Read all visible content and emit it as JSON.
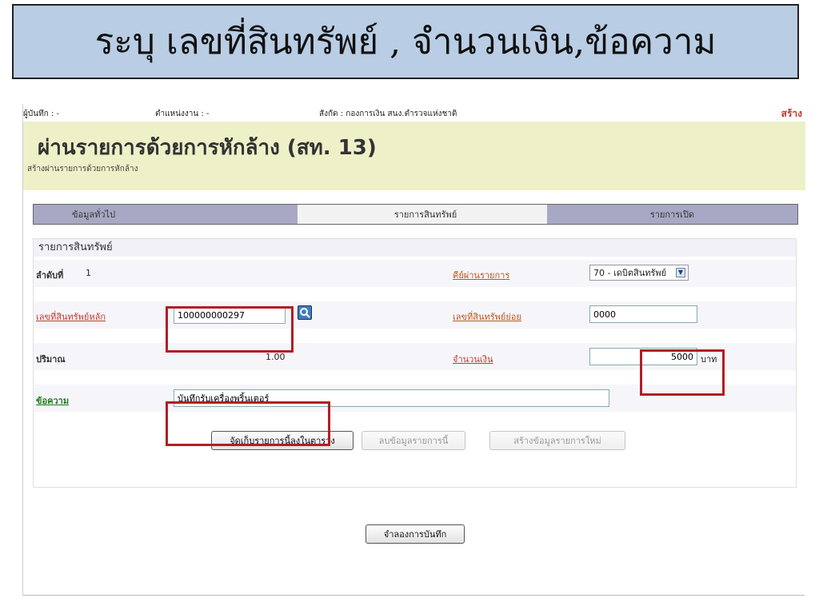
{
  "banner": {
    "text": "ระบุ เลขที่สินทรัพย์ , จำนวนเงิน,ข้อความ"
  },
  "userbar": {
    "recorder": "ผู้บันทึก : -",
    "position": "ตำแหน่งงาน : -",
    "affiliation": "สังกัด : กองการเงิน สนง.ตำรวจแห่งชาติ",
    "create": "สร้าง"
  },
  "header": {
    "title": "ผ่านรายการด้วยการหักล้าง (สท. 13)",
    "subtitle": "สร้างผ่านรายการด้วยการหักล้าง"
  },
  "tabs": {
    "general": "ข้อมูลทั่วไป",
    "asset_items": "รายการสินทรัพย์",
    "open_items": "รายการเปิด"
  },
  "form": {
    "section_title": "รายการสินทรัพย์",
    "seq_label": "ลำดับที่",
    "seq_value": "1",
    "posting_key_label": "คีย์ผ่านรายการ",
    "posting_key_value": "70 - เดบิตสินทรัพย์",
    "main_asset_label": "เลขที่สินทรัพย์หลัก",
    "main_asset_value": "100000000297",
    "sub_asset_label": "เลขที่สินทรัพย์ย่อย",
    "sub_asset_value": "0000",
    "quantity_label": "ปริมาณ",
    "quantity_value": "1.00",
    "amount_label": "จำนวนเงิน",
    "amount_value": "5000",
    "amount_unit": "บาท",
    "text_label": "ข้อความ",
    "text_value": "บันทึกรับเครื่องพริ้นเตอร์"
  },
  "buttons": {
    "save_row": "จัดเก็บรายการนี้ลงในตาราง",
    "delete_row": "ลบข้อมูลรายการนี้",
    "new_row": "สร้างข้อมูลรายการใหม่",
    "simulate": "จำลองการบันทึก"
  },
  "colors": {
    "banner_bg": "#b9cde4",
    "header_bg": "#eef0c8",
    "highlight": "#b21e24",
    "tab_bg": "#a8a8c4"
  }
}
